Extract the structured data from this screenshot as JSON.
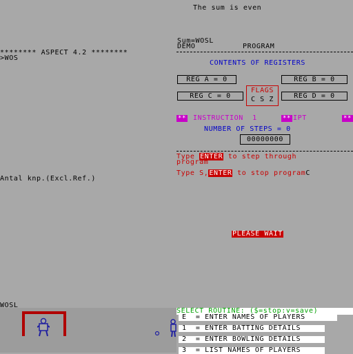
{
  "banner": {
    "text": "The sum is even"
  },
  "left": {
    "title": "******** ASPECT 4.2 ********",
    "prompt": ">WOS",
    "info": "Antal knp.(Excl.Ref.)",
    "footer_label": "WOSL"
  },
  "right": {
    "sum_line": "Sum=WOSL",
    "mode": "DEMO",
    "section": "PROGRAM",
    "contents_title": "CONTENTS OF REGISTERS",
    "reg_a": "REG A = 0",
    "reg_b": "REG B = 0",
    "reg_c": "REG C = 0",
    "reg_d": "REG D = 0",
    "flags_label": "FLAGS",
    "flags_bits": "C S Z",
    "instruction_marker_left": "**",
    "instruction_label": "INSTRUCTION  1",
    "instruction_marker_mid": "**",
    "instruction_op": "IPT",
    "instruction_marker_right": "**",
    "steps_label": "NUMBER OF STEPS = 0",
    "steps_counter": "00000000",
    "step_text_1": "Type ",
    "step_enter_1": "ENTER",
    "step_text_2": " to step through",
    "step_text_3": "program",
    "stop_text_1": "Type S,",
    "stop_enter": "ENTER",
    "stop_text_2": " to stop program",
    "stop_cursor": "C",
    "please_wait": "PLEASE WAIT"
  },
  "menu": {
    "title": "SELECT ROUTINE: ($=stop:v=save)",
    "items": [
      "E  = ENTER NAMES OF PLAYERS",
      "1  = ENTER BATTING DETAILS",
      "2  = ENTER BOWLING DETAILS",
      "3  = LIST NAMES OF PLAYERS"
    ]
  },
  "colors": {
    "background": "#a8a8a8",
    "accent_red": "#c80000",
    "accent_blue": "#0000c8",
    "accent_magenta": "#c800c8"
  }
}
